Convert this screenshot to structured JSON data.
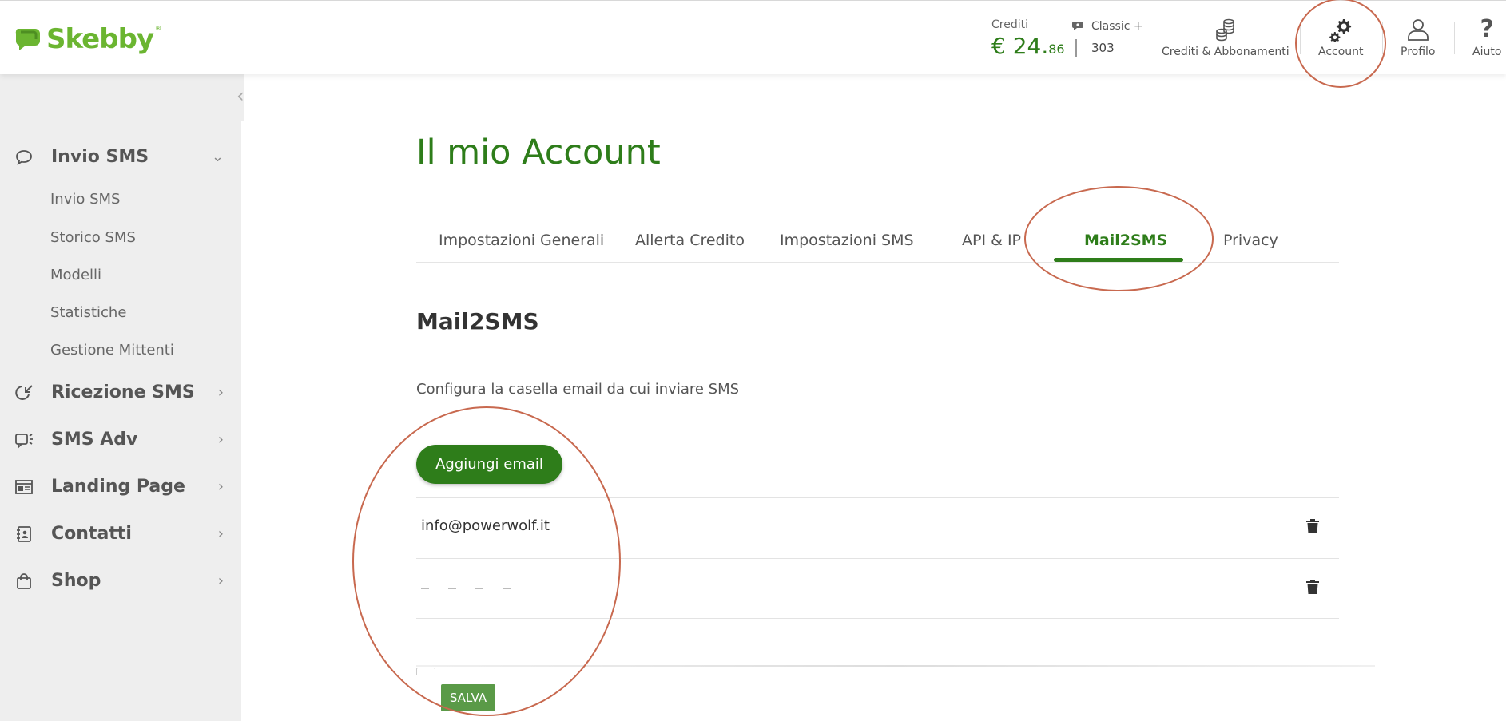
{
  "header": {
    "logo_text": "Skebby",
    "logo_reg": "®",
    "credits_label": "Crediti",
    "credits_int": "€ 24.",
    "credits_dec": "86",
    "classic_label": "Classic +",
    "classic_value": "303",
    "nav": [
      {
        "label": "Crediti & Abbonamenti",
        "icon": "coins-icon"
      },
      {
        "label": "Account",
        "icon": "gear-icon"
      },
      {
        "label": "Profilo",
        "icon": "user-icon"
      },
      {
        "label": "Aiuto",
        "icon": "help-icon"
      }
    ]
  },
  "sidebar": {
    "sections": [
      {
        "label": "Invio SMS",
        "icon": "chat-bubble-icon",
        "expanded": true,
        "items": [
          "Invio SMS",
          "Storico SMS",
          "Modelli",
          "Statistiche",
          "Gestione Mittenti"
        ]
      },
      {
        "label": "Ricezione SMS",
        "icon": "receive-icon"
      },
      {
        "label": "SMS Adv",
        "icon": "megaphone-icon"
      },
      {
        "label": "Landing Page",
        "icon": "page-icon"
      },
      {
        "label": "Contatti",
        "icon": "contacts-icon"
      },
      {
        "label": "Shop",
        "icon": "shopping-bag-icon"
      }
    ]
  },
  "main": {
    "title": "Il mio Account",
    "tabs": [
      {
        "label": "Impostazioni Generali"
      },
      {
        "label": "Allerta Credito"
      },
      {
        "label": "Impostazioni SMS"
      },
      {
        "label": "API & IP"
      },
      {
        "label": "Mail2SMS",
        "active": true
      },
      {
        "label": "Privacy"
      }
    ],
    "section_title": "Mail2SMS",
    "section_desc": "Configura la casella email da cui inviare SMS",
    "add_button": "Aggiungi email",
    "emails": [
      "info@powerwolf.it",
      ""
    ],
    "save_button": "SALVA"
  },
  "colors": {
    "brand_green": "#2e7d1a",
    "logo_green": "#6bb531",
    "sidebar_bg": "#eeeeee",
    "annotation": "#c8694f"
  }
}
